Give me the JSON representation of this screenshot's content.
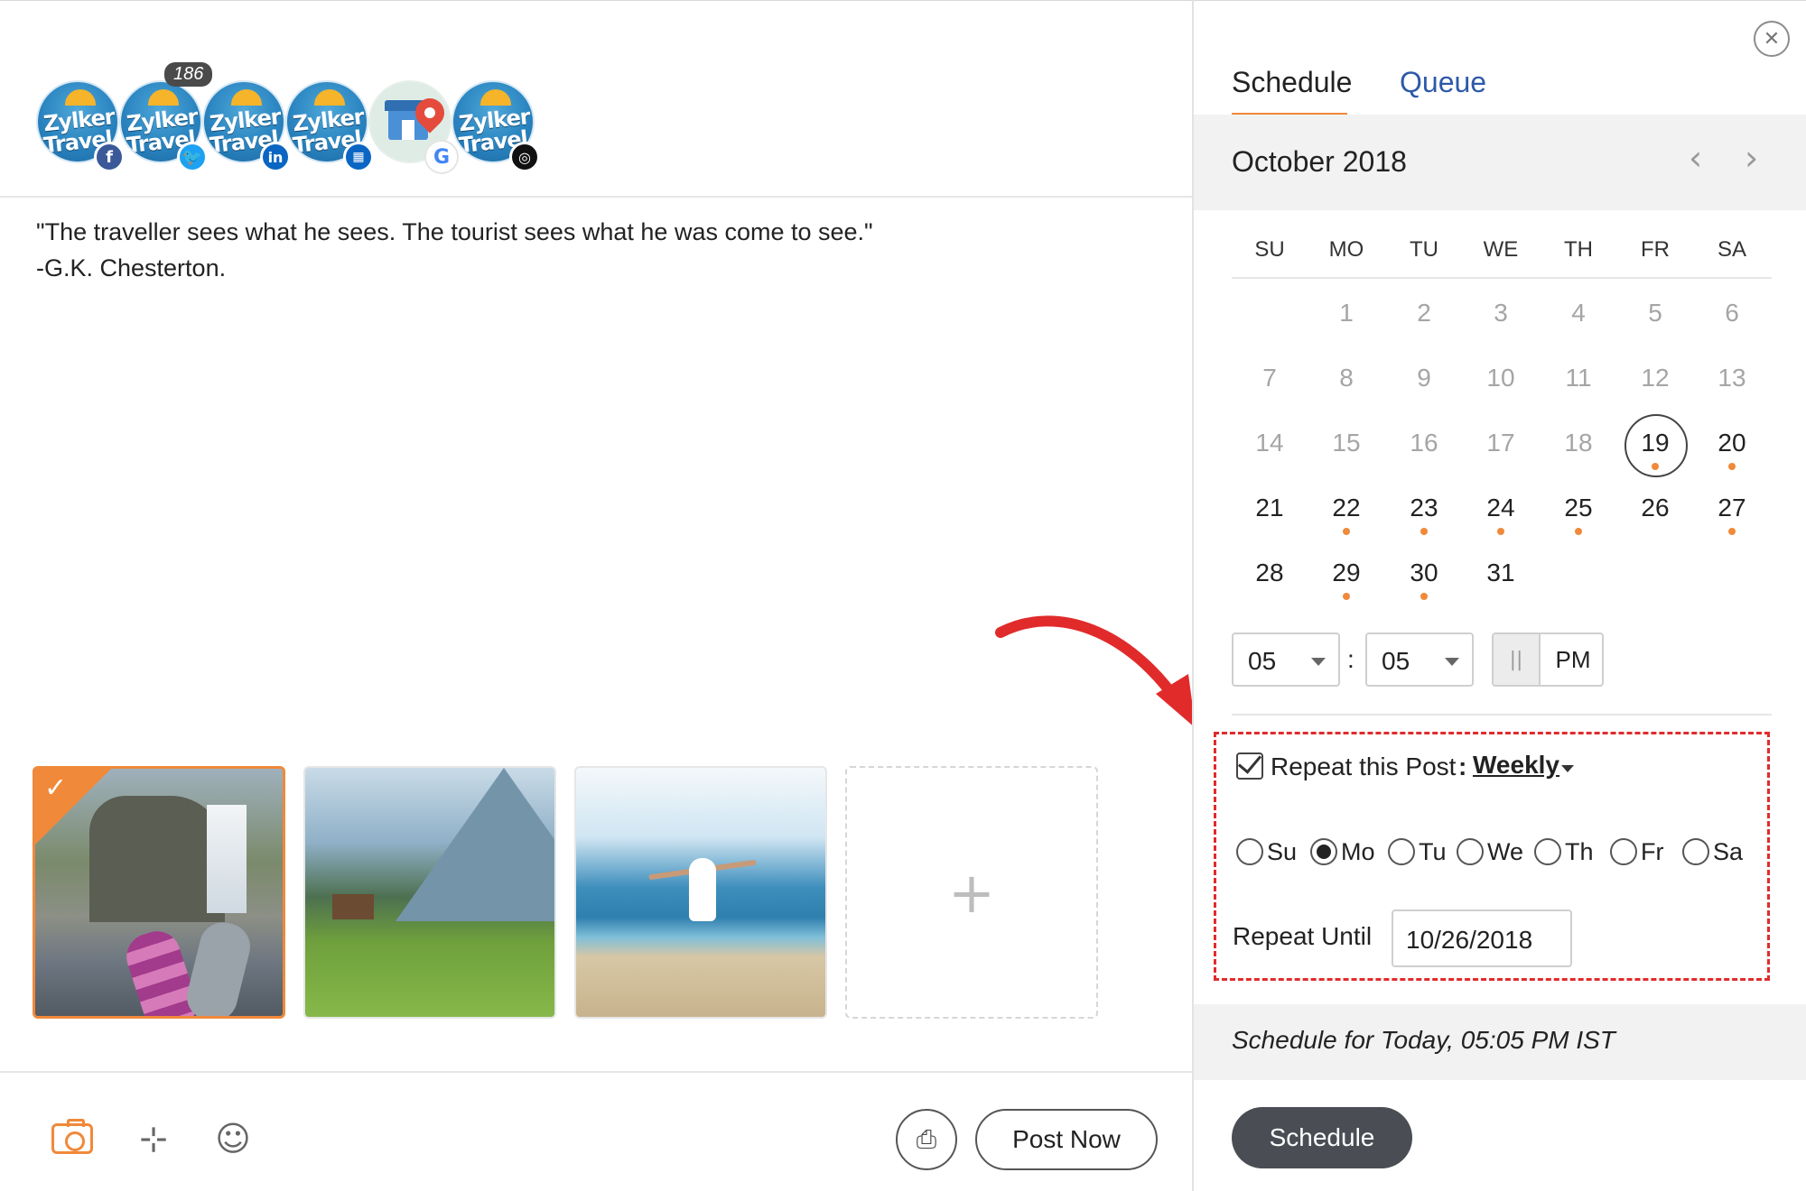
{
  "profiles": [
    {
      "line1": "Zylker",
      "line2": "Travel",
      "network": "facebook",
      "badge": "f"
    },
    {
      "line1": "Zylker",
      "line2": "Travel",
      "network": "twitter",
      "badge": "🐦",
      "count": "186"
    },
    {
      "line1": "Zylker",
      "line2": "Travel",
      "network": "linkedin",
      "badge": "in"
    },
    {
      "line1": "Zylker",
      "line2": "Travel",
      "network": "linkedin-company",
      "badge": "▦"
    },
    {
      "network": "google-my-business",
      "badge": "G"
    },
    {
      "line1": "Zylker",
      "line2": "Travel",
      "network": "instagram",
      "badge": "◎"
    }
  ],
  "post": {
    "line1": "\"The traveller sees what he sees. The tourist sees what he was come to see.\"",
    "line2": "-G.K. Chesterton."
  },
  "media": {
    "add_label": "+"
  },
  "toolbar": {
    "note_icon": "⊹",
    "emoji_icon": "☺",
    "drafts_icon": "⎙",
    "post_now_label": "Post Now"
  },
  "schedule_panel": {
    "close_icon": "✕",
    "tabs": [
      {
        "label": "Schedule"
      },
      {
        "label": "Queue"
      }
    ],
    "month_title": "October 2018",
    "prev_icon": "‹",
    "next_icon": "›",
    "weekdays": [
      "SU",
      "MO",
      "TU",
      "WE",
      "TH",
      "FR",
      "SA"
    ],
    "weeks": [
      [
        "",
        "1",
        "2",
        "3",
        "4",
        "5",
        "6"
      ],
      [
        "7",
        "8",
        "9",
        "10",
        "11",
        "12",
        "13"
      ],
      [
        "14",
        "15",
        "16",
        "17",
        "18",
        "19",
        "20"
      ],
      [
        "21",
        "22",
        "23",
        "24",
        "25",
        "26",
        "27"
      ],
      [
        "28",
        "29",
        "30",
        "31",
        "",
        "",
        ""
      ]
    ],
    "selected_day": "19",
    "scheduled_days": [
      "19",
      "20",
      "22",
      "23",
      "24",
      "25",
      "27",
      "29",
      "30"
    ],
    "hour": "05",
    "minute": "05",
    "am_label": "||",
    "pm_label": "PM",
    "repeat": {
      "label": "Repeat this Post",
      "colon": ":",
      "frequency": "Weekly",
      "checked": true,
      "days": [
        {
          "label": "Su",
          "selected": false
        },
        {
          "label": "Mo",
          "selected": true
        },
        {
          "label": "Tu",
          "selected": false
        },
        {
          "label": "We",
          "selected": false
        },
        {
          "label": "Th",
          "selected": false
        },
        {
          "label": "Fr",
          "selected": false
        },
        {
          "label": "Sa",
          "selected": false
        }
      ],
      "until_label": "Repeat Until",
      "until_value": "10/26/2018"
    },
    "summary": "Schedule for Today, 05:05 PM IST",
    "schedule_button": "Schedule"
  },
  "colors": {
    "accent": "#f0893a",
    "queue_tab": "#2d5aa8",
    "annotation_red": "#e12b2b",
    "schedule_button_bg": "#4a4e54"
  }
}
